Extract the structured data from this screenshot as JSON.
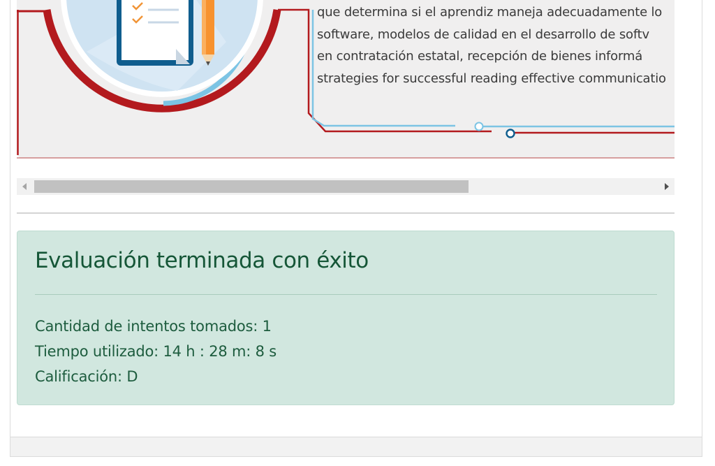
{
  "banner": {
    "text_lines": [
      "que determina si el aprendiz maneja adecuadamente lo",
      "software, modelos de calidad en el desarrollo de softv",
      "en contratación estatal, recepción de bienes informá",
      "strategies for successful reading effective communicatio"
    ],
    "colors": {
      "accent_red": "#b31a1e",
      "accent_blue": "#7cc4e4",
      "background": "#f0efef"
    },
    "icons": [
      "clipboard-checklist-icon",
      "pencil-icon"
    ]
  },
  "scrollbar": {
    "position": 0.0,
    "visible_fraction": 0.66
  },
  "result": {
    "heading": "Evaluación terminada con éxito",
    "attempts": "Cantidad de intentos tomados: 1",
    "time_used": "Tiempo utilizado: 14 h : 28 m: 8 s",
    "grade": "Calificación: D",
    "colors": {
      "background": "#d1e7df",
      "text": "#155637",
      "border": "#bedcd1"
    }
  }
}
